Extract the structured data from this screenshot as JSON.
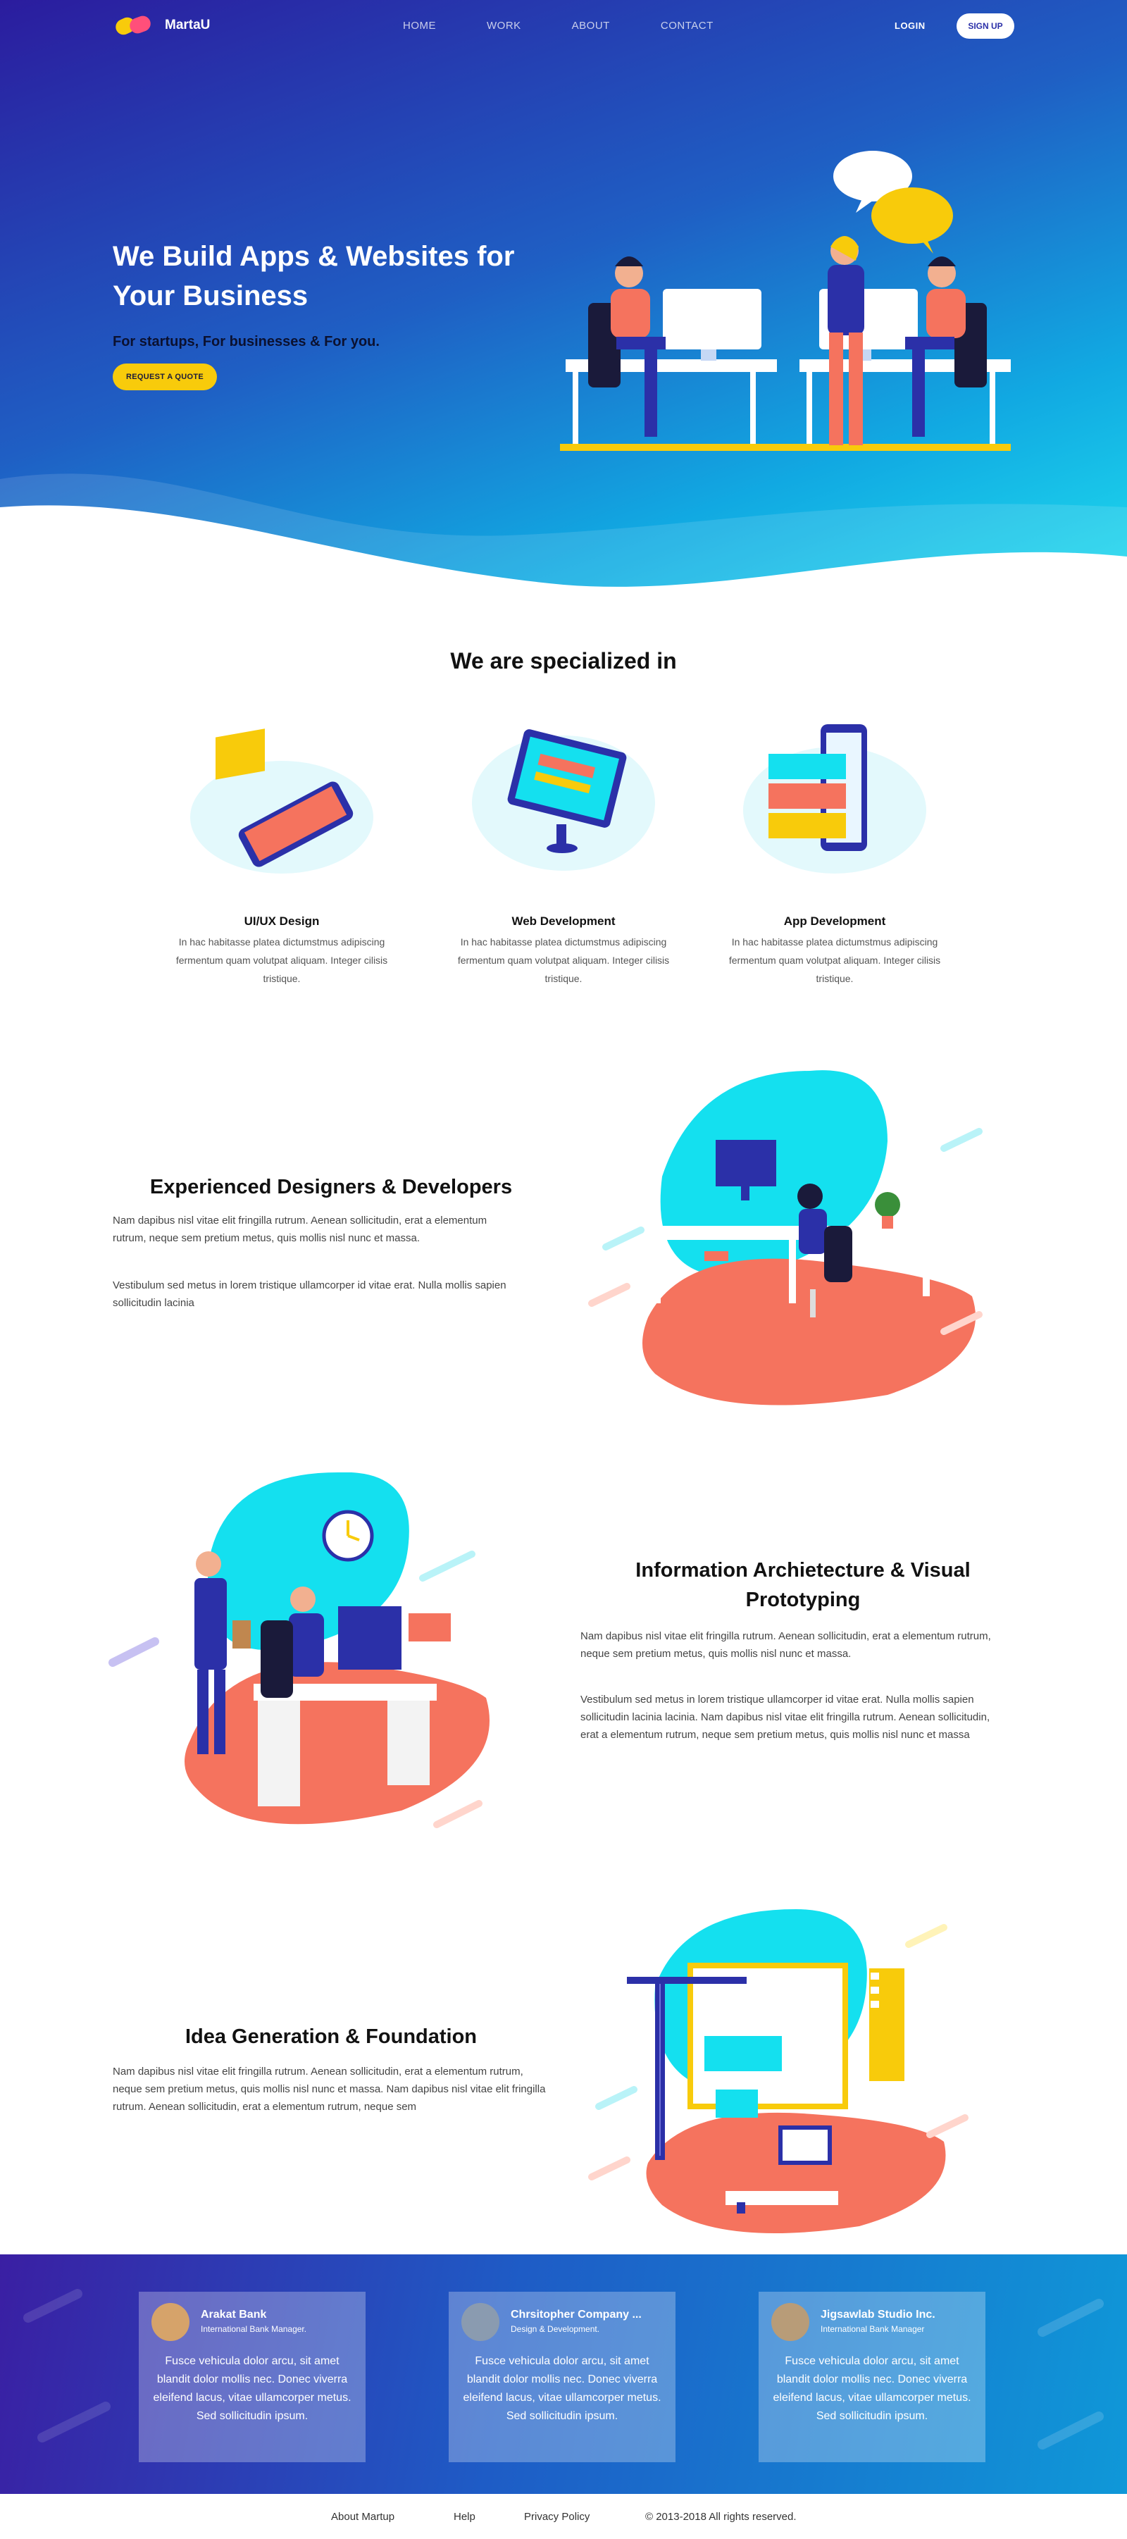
{
  "brand": {
    "name": "MartaU",
    "colors": {
      "accent": "#f8cb0b",
      "primary": "#2b30a8",
      "coral": "#f5735e",
      "cyan": "#14e0ef"
    }
  },
  "nav": {
    "items": [
      "HOME",
      "WORK",
      "ABOUT",
      "CONTACT"
    ],
    "login": "LOGIN",
    "signup": "SIGN UP"
  },
  "hero": {
    "title": "We Build Apps & Websites for Your Business",
    "subtitle": "For startups, For businesses & For you.",
    "cta": "REQUEST A QUOTE"
  },
  "specialized": {
    "title": "We are specialized in",
    "services": [
      {
        "title": "UI/UX Design",
        "desc": "In hac habitasse platea dictumstmus adipiscing fermentum quam volutpat aliquam. Integer cilisis tristique.",
        "icon": "mobile-design-icon"
      },
      {
        "title": "Web Development",
        "desc": "In hac habitasse platea dictumstmus adipiscing fermentum quam volutpat aliquam. Integer cilisis tristique.",
        "icon": "monitor-icon"
      },
      {
        "title": "App Development",
        "desc": "In hac habitasse platea dictumstmus adipiscing fermentum quam volutpat aliquam. Integer cilisis tristique.",
        "icon": "phone-app-icon"
      }
    ]
  },
  "features": [
    {
      "title": "Experienced Designers & Developers",
      "paragraphs": [
        "Nam dapibus nisl vitae elit fringilla rutrum. Aenean sollicitudin, erat a elementum rutrum, neque sem pretium metus, quis mollis nisl nunc et massa.",
        "Vestibulum sed metus in lorem tristique ullamcorper id vitae erat. Nulla mollis sapien sollicitudin lacinia"
      ]
    },
    {
      "title": "Information Archietecture & Visual Prototyping",
      "paragraphs": [
        "Nam dapibus nisl vitae elit fringilla rutrum. Aenean sollicitudin, erat a elementum rutrum, neque sem pretium metus, quis mollis nisl nunc et massa.",
        "Vestibulum sed metus in lorem tristique ullamcorper id vitae erat. Nulla mollis sapien sollicitudin lacinia lacinia. Nam dapibus nisl vitae elit fringilla rutrum. Aenean sollicitudin, erat a elementum rutrum, neque sem pretium metus, quis mollis nisl nunc et massa"
      ]
    },
    {
      "title": "Idea Generation & Foundation",
      "paragraphs": [
        "Nam dapibus nisl vitae elit fringilla rutrum. Aenean sollicitudin, erat a elementum rutrum, neque sem pretium metus, quis mollis nisl nunc et massa. Nam dapibus nisl vitae elit fringilla rutrum. Aenean sollicitudin, erat a elementum rutrum, neque sem"
      ]
    }
  ],
  "testimonials": [
    {
      "name": "Arakat Bank",
      "role": "International Bank Manager.",
      "text": "Fusce vehicula dolor arcu, sit amet blandit dolor mollis nec. Donec viverra eleifend lacus, vitae ullamcorper metus. Sed sollicitudin ipsum."
    },
    {
      "name": "Chrsitopher Company ...",
      "role": "Design & Development.",
      "text": "Fusce vehicula dolor arcu, sit amet blandit dolor mollis nec. Donec viverra eleifend lacus, vitae ullamcorper metus. Sed sollicitudin ipsum."
    },
    {
      "name": "Jigsawlab Studio Inc.",
      "role": "International Bank Manager",
      "text": "Fusce vehicula dolor arcu, sit amet blandit dolor mollis nec. Donec viverra eleifend lacus, vitae ullamcorper metus. Sed sollicitudin ipsum."
    }
  ],
  "footer": {
    "links": [
      "About Martup",
      "Help",
      "Privacy Policy"
    ],
    "copyright": "© 2013-2018 All rights reserved."
  }
}
